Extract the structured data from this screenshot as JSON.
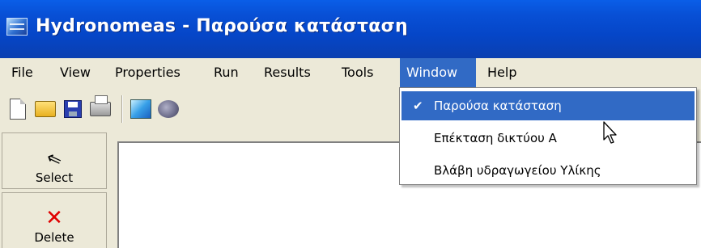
{
  "window": {
    "title": "Hydronomeas - Παρούσα κατάσταση",
    "icon": "hydronomeas-app-icon",
    "title_bar_color": "#0a5ee8"
  },
  "menu": {
    "items": [
      {
        "label": "File"
      },
      {
        "label": "View"
      },
      {
        "label": "Properties"
      },
      {
        "label": "Run"
      },
      {
        "label": "Results"
      },
      {
        "label": "Tools"
      },
      {
        "label": "Window",
        "active": true
      },
      {
        "label": "Help"
      }
    ],
    "highlight_color": "#316ac5"
  },
  "toolbar": {
    "buttons": [
      {
        "icon": "new-document-icon"
      },
      {
        "icon": "open-folder-icon"
      },
      {
        "icon": "save-disk-icon"
      },
      {
        "icon": "printer-icon"
      },
      {
        "icon": "hydronomeas-icon"
      },
      {
        "icon": "brain-icon"
      }
    ]
  },
  "side_panel": {
    "select": {
      "label": "Select",
      "icon": "arrow-cursor-icon"
    },
    "delete": {
      "label": "Delete",
      "icon": "red-x-icon"
    }
  },
  "window_menu": {
    "items": [
      {
        "label": "Παρούσα κατάσταση",
        "checked": true,
        "highlighted": true
      },
      {
        "label": "Επέκταση δικτύου Α",
        "checked": false
      },
      {
        "label": "Βλάβη υδραγωγείου Υλίκης",
        "checked": false
      }
    ]
  },
  "icons": {
    "checkmark": "✔",
    "cursor": "⇖",
    "delete_x": "✕"
  }
}
